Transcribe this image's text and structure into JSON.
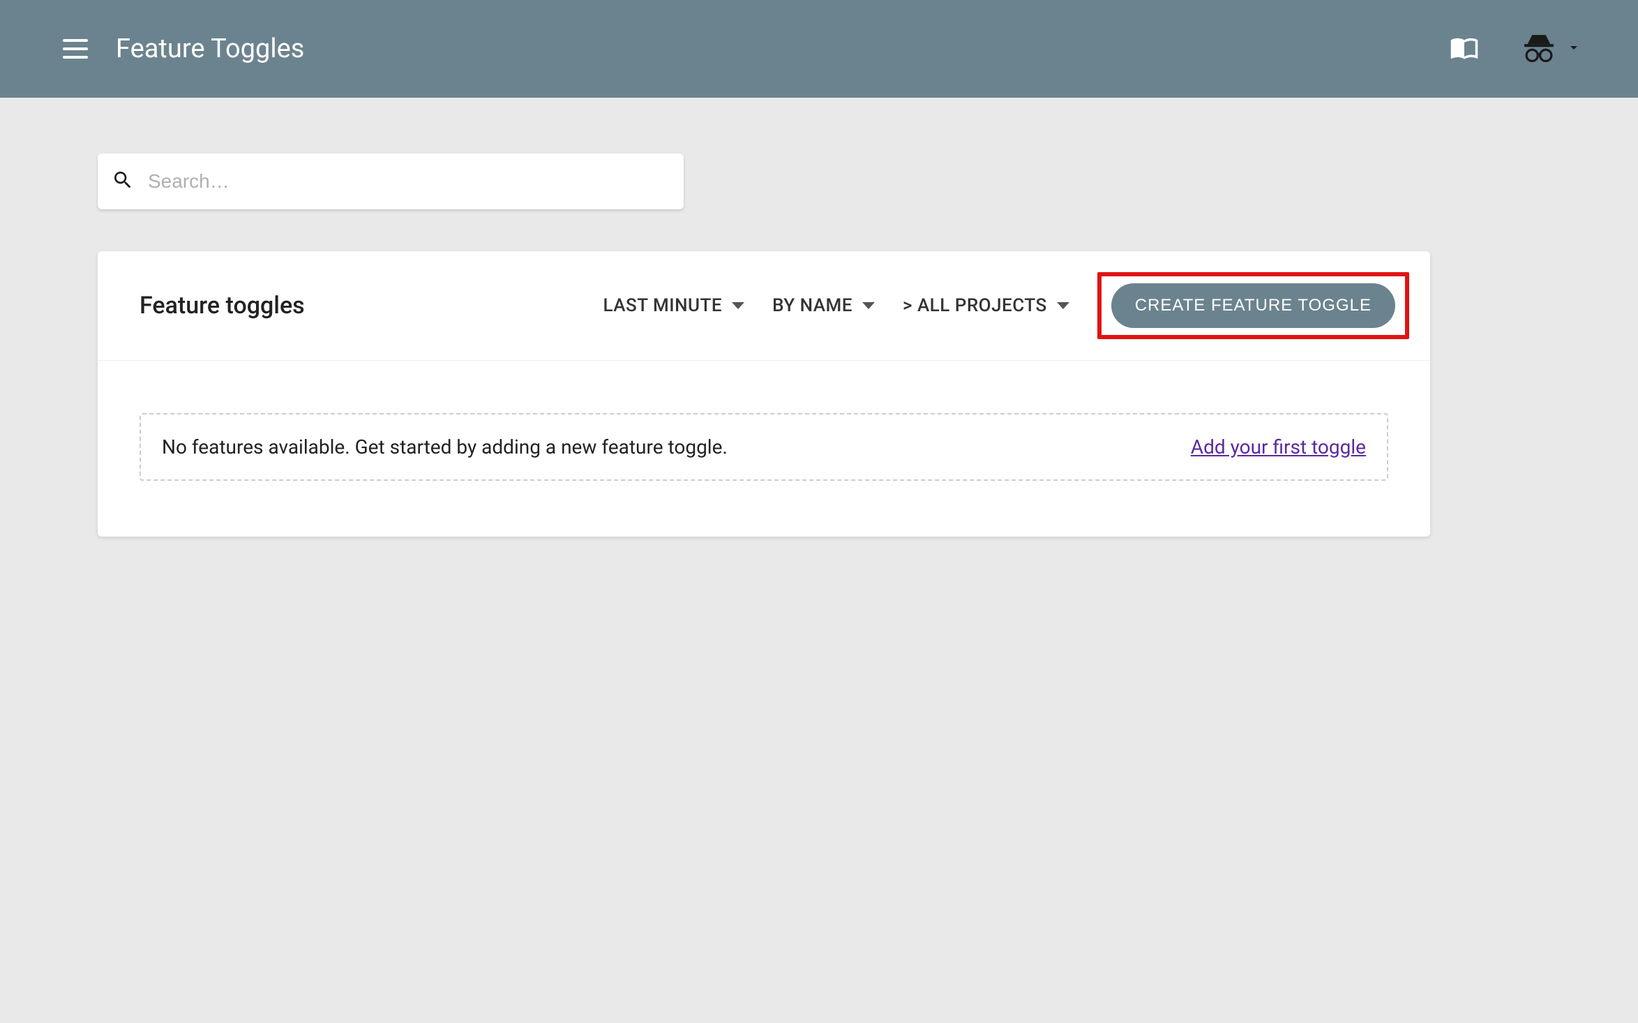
{
  "header": {
    "title": "Feature Toggles"
  },
  "search": {
    "placeholder": "Search…",
    "value": ""
  },
  "card": {
    "title": "Feature toggles",
    "filters": {
      "time": "LAST MINUTE",
      "sort": "BY NAME",
      "project": "> ALL PROJECTS"
    },
    "create_label": "CREATE FEATURE TOGGLE",
    "empty": {
      "message": "No features available. Get started by adding a new feature toggle.",
      "link_label": "Add your first toggle"
    }
  }
}
